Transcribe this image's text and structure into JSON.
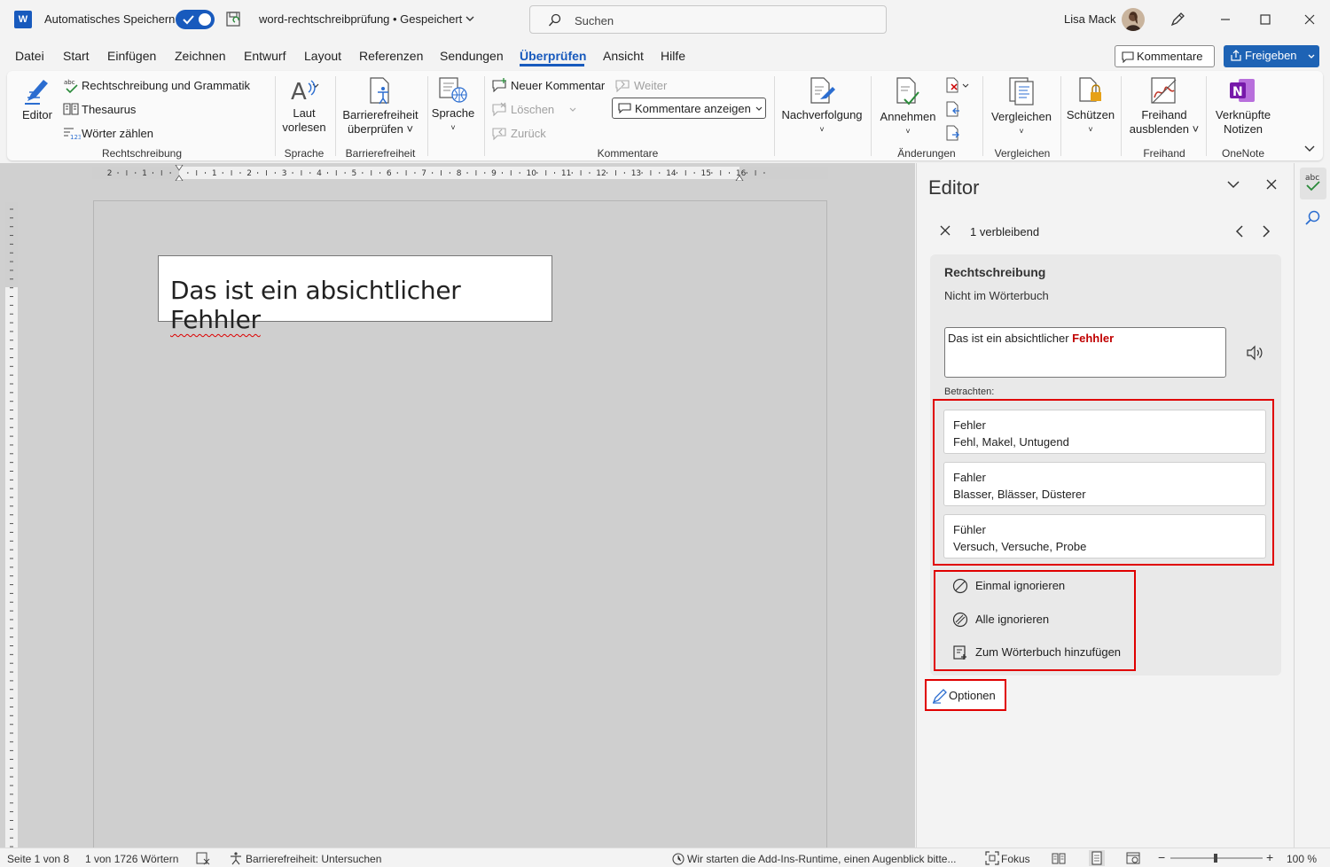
{
  "titlebar": {
    "app_logo": "W",
    "autosave_label": "Automatisches Speichern",
    "document_title": "word-rechtschreibprüfung • Gespeichert",
    "search_placeholder": "Suchen",
    "user_name": "Lisa Mack"
  },
  "menu": {
    "tabs": [
      "Datei",
      "Start",
      "Einfügen",
      "Zeichnen",
      "Entwurf",
      "Layout",
      "Referenzen",
      "Sendungen",
      "Überprüfen",
      "Ansicht",
      "Hilfe"
    ],
    "active_tab": "Überprüfen",
    "comments_button": "Kommentare",
    "share_button": "Freigeben"
  },
  "ribbon": {
    "editor": "Editor",
    "spelling_grammar": "Rechtschreibung und Grammatik",
    "thesaurus": "Thesaurus",
    "word_count": "Wörter zählen",
    "group_rechtschreibung": "Rechtschreibung",
    "read_aloud_1": "Laut",
    "read_aloud_2": "vorlesen",
    "group_sprache": "Sprache",
    "accessibility_1": "Barrierefreiheit",
    "accessibility_2": "überprüfen",
    "group_barrierefreiheit": "Barrierefreiheit",
    "language": "Sprache",
    "new_comment": "Neuer Kommentar",
    "delete": "Löschen",
    "back": "Zurück",
    "next": "Weiter",
    "show_comments": "Kommentare anzeigen",
    "group_kommentare": "Kommentare",
    "tracking": "Nachverfolgung",
    "accept": "Annehmen",
    "group_aenderungen": "Änderungen",
    "compare": "Vergleichen",
    "group_vergleichen": "Vergleichen",
    "protect": "Schützen",
    "ink_hide_1": "Freihand",
    "ink_hide_2": "ausblenden",
    "group_freihand": "Freihand",
    "linked_notes_1": "Verknüpfte",
    "linked_notes_2": "Notizen",
    "group_onenote": "OneNote"
  },
  "document": {
    "text_before": "Das ist ein absichtlicher ",
    "text_error": "Fehhler"
  },
  "editor_pane": {
    "title": "Editor",
    "remaining": "1 verbleibend",
    "category": "Rechtschreibung",
    "reason": "Nicht im Wörterbuch",
    "context_before": "Das ist ein absichtlicher ",
    "context_error": "Fehhler",
    "consider_label": "Betrachten:",
    "suggestions": [
      {
        "word": "Fehler",
        "synonyms": "Fehl, Makel, Untugend"
      },
      {
        "word": "Fahler",
        "synonyms": "Blasser, Blässer, Düsterer"
      },
      {
        "word": "Fühler",
        "synonyms": "Versuch, Versuche, Probe"
      }
    ],
    "actions": {
      "ignore_once": "Einmal ignorieren",
      "ignore_all": "Alle ignorieren",
      "add_to_dictionary": "Zum Wörterbuch hinzufügen"
    },
    "options": "Optionen"
  },
  "statusbar": {
    "page": "Seite 1 von 8",
    "words": "1 von 1726 Wörtern",
    "accessibility": "Barrierefreiheit: Untersuchen",
    "addins": "Wir starten die Add-Ins-Runtime, einen Augenblick bitte...",
    "focus": "Fokus",
    "zoom": "100 %"
  },
  "colors": {
    "accent": "#185abd",
    "highlight_frame": "#e00000",
    "error_text": "#c00000"
  }
}
